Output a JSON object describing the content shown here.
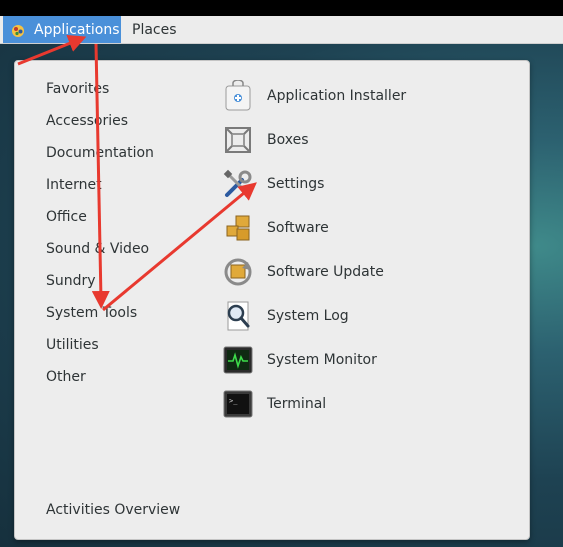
{
  "topbar": {
    "applications_label": "Applications",
    "places_label": "Places"
  },
  "categories": [
    "Favorites",
    "Accessories",
    "Documentation",
    "Internet",
    "Office",
    "Sound & Video",
    "Sundry",
    "System Tools",
    "Utilities",
    "Other"
  ],
  "apps": [
    {
      "label": "Application Installer",
      "icon": "package-installer-icon"
    },
    {
      "label": "Boxes",
      "icon": "boxes-icon"
    },
    {
      "label": "Settings",
      "icon": "settings-tools-icon"
    },
    {
      "label": "Software",
      "icon": "software-packages-icon"
    },
    {
      "label": "Software Update",
      "icon": "software-update-icon"
    },
    {
      "label": "System Log",
      "icon": "system-log-icon"
    },
    {
      "label": "System Monitor",
      "icon": "system-monitor-icon"
    },
    {
      "label": "Terminal",
      "icon": "terminal-icon"
    }
  ],
  "activities_overview": "Activities Overview",
  "colors": {
    "accent": "#4a90d9",
    "annotation_arrow": "#e8392f"
  }
}
